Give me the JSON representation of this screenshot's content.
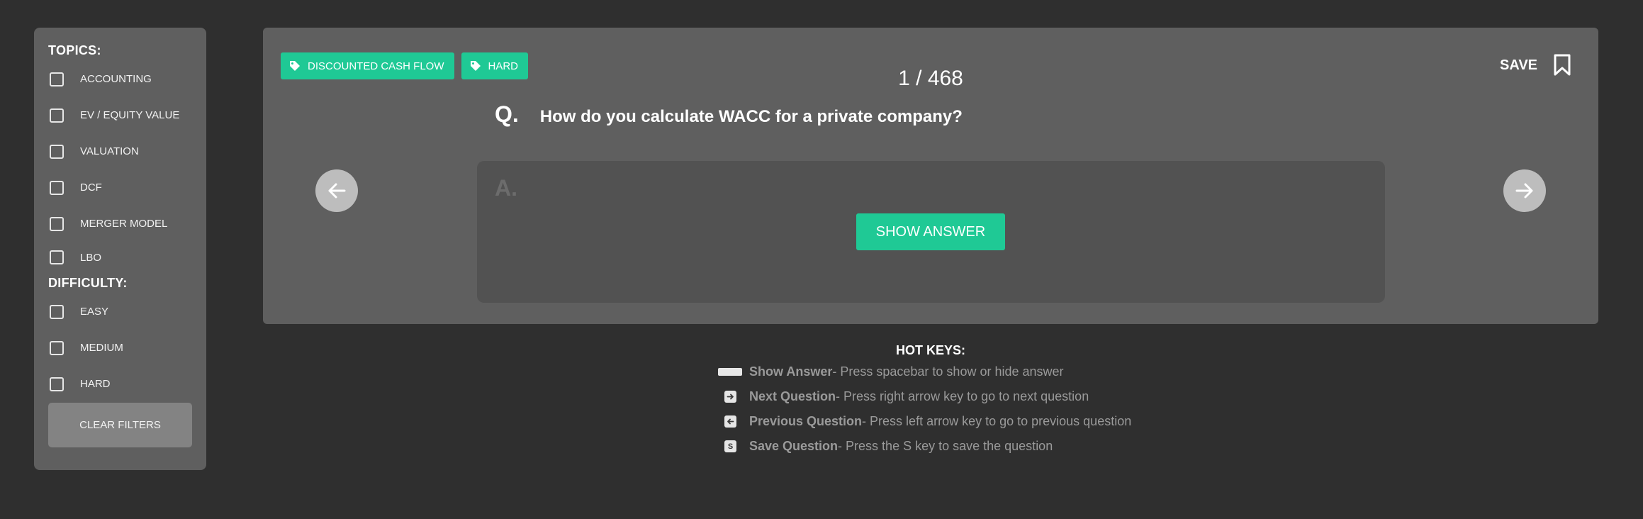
{
  "sidebar": {
    "topics_title": "TOPICS:",
    "topics": [
      {
        "label": "ACCOUNTING",
        "checked": false
      },
      {
        "label": "EV / EQUITY VALUE",
        "checked": false
      },
      {
        "label": "VALUATION",
        "checked": false
      },
      {
        "label": "DCF",
        "checked": false
      },
      {
        "label": "MERGER MODEL",
        "checked": false
      },
      {
        "label": "LBO",
        "checked": false
      }
    ],
    "difficulty_title": "DIFFICULTY:",
    "difficulties": [
      {
        "label": "EASY",
        "checked": false
      },
      {
        "label": "MEDIUM",
        "checked": false
      },
      {
        "label": "HARD",
        "checked": false
      }
    ],
    "clear_label": "CLEAR FILTERS"
  },
  "card": {
    "tags": [
      {
        "label": "DISCOUNTED CASH FLOW",
        "icon": "tag-icon"
      },
      {
        "label": "HARD",
        "icon": "tag-icon"
      }
    ],
    "counter": "1 / 468",
    "save_label": "SAVE",
    "question_mark": "Q.",
    "question_text": "How do you calculate WACC for a private company?",
    "answer_mark": "A.",
    "show_answer_label": "SHOW ANSWER"
  },
  "hotkeys": {
    "title": "HOT KEYS:",
    "items": [
      {
        "key_icon": "spacebar-icon",
        "name": "Show Answer",
        "desc": " - Press spacebar to show or hide answer"
      },
      {
        "key_icon": "arrow-right-key-icon",
        "name": "Next Question",
        "desc": " - Press right arrow key to go to next question"
      },
      {
        "key_icon": "arrow-left-key-icon",
        "name": "Previous Question",
        "desc": " - Press left arrow key to go to previous question"
      },
      {
        "key_icon": "s-key-icon",
        "key_text": "S",
        "name": "Save Question",
        "desc": "- Press the S key to save the question"
      }
    ]
  },
  "colors": {
    "accent": "#1fc995",
    "background": "#2f2f2f",
    "panel": "#5f5f5f",
    "answer_box": "#525252"
  }
}
